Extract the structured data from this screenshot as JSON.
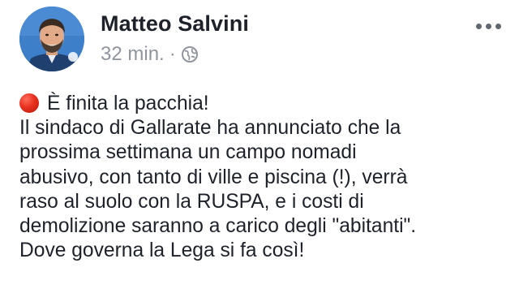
{
  "post": {
    "author": {
      "name": "Matteo Salvini",
      "avatar_icon": "profile-photo"
    },
    "meta": {
      "timestamp": "32 min.",
      "separator": "·",
      "audience_icon": "globe-icon"
    },
    "more_icon": "more-options-icon",
    "text": {
      "line1": "È finita la pacchia!",
      "line1_emoji": "red-circle-icon",
      "line2": "Il sindaco di Gallarate ha annunciato che la",
      "line3": "prossima settimana un campo nomadi",
      "line4": "abusivo, con tanto di ville e piscina (!), verrà",
      "line5": "raso al suolo con la RUSPA, e i costi di",
      "line6": "demolizione saranno a carico degli \"abitanti\".",
      "line7": "Dove governa la Lega si fa così!"
    },
    "colors": {
      "text": "#1d2129",
      "meta": "#90949c",
      "emoji_red": "#e8311f"
    }
  }
}
